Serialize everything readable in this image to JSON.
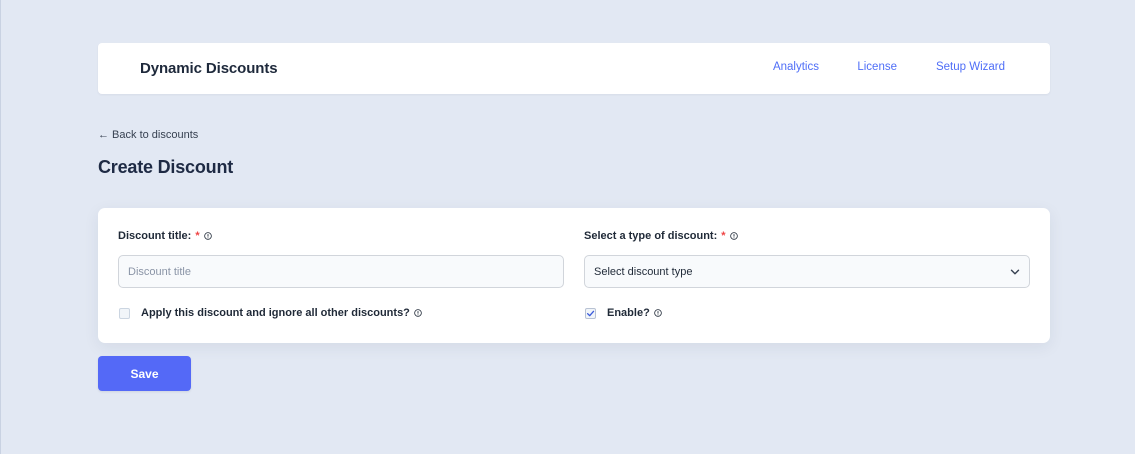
{
  "header": {
    "brand": "Dynamic Discounts",
    "nav": [
      {
        "label": "Analytics"
      },
      {
        "label": "License"
      },
      {
        "label": "Setup Wizard"
      }
    ]
  },
  "breadcrumb": {
    "back_label": "← Back to discounts"
  },
  "page": {
    "title": "Create Discount"
  },
  "form": {
    "title_field": {
      "label": "Discount title:",
      "required_marker": "*",
      "placeholder": "Discount title",
      "value": ""
    },
    "type_field": {
      "label": "Select a type of discount:",
      "required_marker": "*",
      "selected": "Select discount type"
    },
    "exclusive_checkbox": {
      "label": "Apply this discount and ignore all other discounts?",
      "checked": false
    },
    "enable_checkbox": {
      "label": "Enable?",
      "checked": true
    }
  },
  "actions": {
    "save_label": "Save"
  },
  "colors": {
    "accent": "#5469f7",
    "link": "#4f6ef7",
    "required": "#ef4444",
    "background": "#e2e8f3"
  }
}
